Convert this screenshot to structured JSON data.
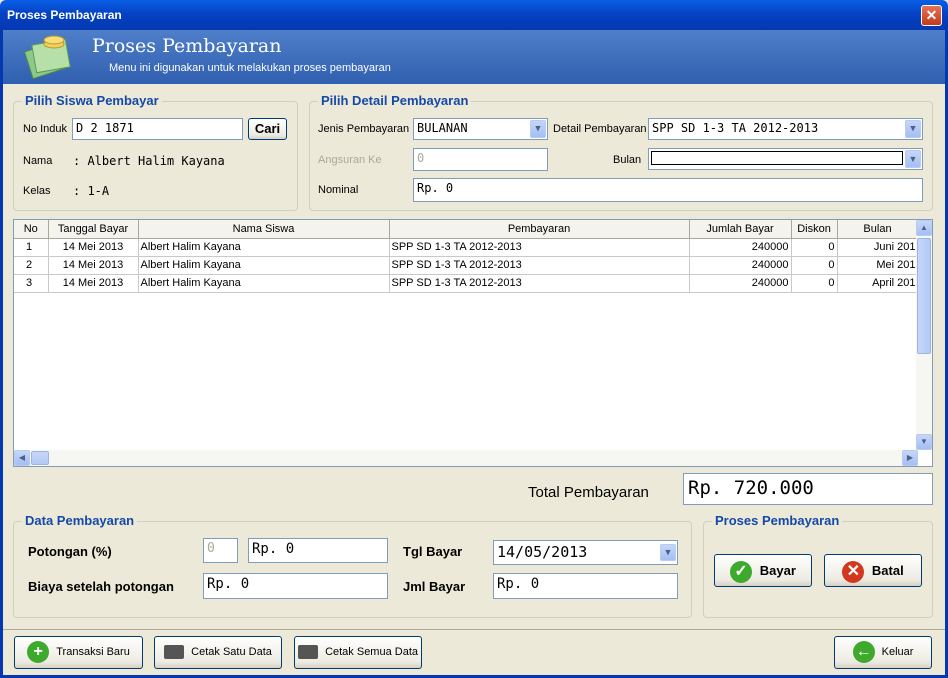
{
  "window": {
    "title": "Proses Pembayaran",
    "close": "✕"
  },
  "banner": {
    "title": "Proses Pembayaran",
    "subtitle": "Menu ini digunakan untuk melakukan proses pembayaran"
  },
  "siswa": {
    "legend": "Pilih Siswa Pembayar",
    "no_induk_label": "No Induk",
    "no_induk_value": "D 2 1871",
    "cari_label": "Cari",
    "nama_label": "Nama",
    "nama_value": ": Albert Halim Kayana",
    "kelas_label": "Kelas",
    "kelas_value": ": 1-A"
  },
  "detail": {
    "legend": "Pilih Detail Pembayaran",
    "jenis_label": "Jenis Pembayaran",
    "jenis_value": "BULANAN",
    "detail_label": "Detail Pembayaran",
    "detail_value": "SPP SD 1-3 TA 2012-2013",
    "angsuran_label": "Angsuran Ke",
    "angsuran_value": "0",
    "bulan_label": "Bulan",
    "bulan_value": "",
    "nominal_label": "Nominal",
    "nominal_value": "Rp. 0"
  },
  "table": {
    "headers": [
      "No",
      "Tanggal Bayar",
      "Nama Siswa",
      "Pembayaran",
      "Jumlah Bayar",
      "Diskon",
      "Bulan"
    ],
    "rows": [
      [
        "1",
        "14 Mei 2013",
        "Albert Halim Kayana",
        "SPP SD 1-3 TA 2012-2013",
        "240000",
        "0",
        "Juni 201"
      ],
      [
        "2",
        "14 Mei 2013",
        "Albert Halim Kayana",
        "SPP SD 1-3 TA 2012-2013",
        "240000",
        "0",
        "Mei 201"
      ],
      [
        "3",
        "14 Mei 2013",
        "Albert Halim Kayana",
        "SPP SD 1-3 TA 2012-2013",
        "240000",
        "0",
        "April 201"
      ]
    ]
  },
  "total": {
    "label": "Total Pembayaran",
    "value": "Rp. 720.000"
  },
  "data_pembayaran": {
    "legend": "Data Pembayaran",
    "potongan_label": "Potongan (%)",
    "potongan_pct": "0",
    "potongan_value": "Rp. 0",
    "biaya_label": "Biaya setelah potongan",
    "biaya_value": "Rp. 0",
    "tgl_label": "Tgl Bayar",
    "tgl_value": "14/05/2013",
    "jml_label": "Jml Bayar",
    "jml_value": "Rp. 0"
  },
  "proses": {
    "legend": "Proses Pembayaran",
    "bayar_label": "Bayar",
    "batal_label": "Batal"
  },
  "footer": {
    "transaksi_baru": "Transaksi Baru",
    "cetak_satu": "Cetak Satu Data",
    "cetak_semua": "Cetak Semua Data",
    "keluar": "Keluar"
  },
  "colors": {
    "title_bar": "#0542C4",
    "banner": "#3E6DBE",
    "legend": "#1549A8",
    "ok_green": "#3DAA2E",
    "cancel_red": "#D4371F"
  }
}
